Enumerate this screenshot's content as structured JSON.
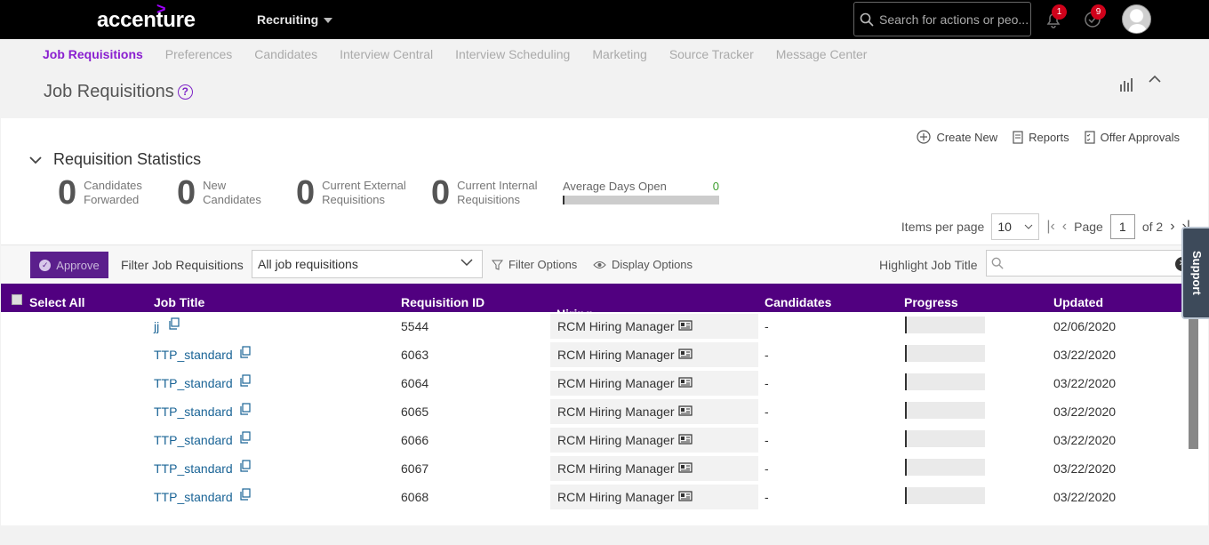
{
  "header": {
    "logo_text": "accenture",
    "logo_mark": ">",
    "module": "Recruiting",
    "search_placeholder": "Search for actions or peo...",
    "notifications_count": "1",
    "approvals_count": "9"
  },
  "subnav": {
    "items": [
      "Job Requisitions",
      "Preferences",
      "Candidates",
      "Interview Central",
      "Interview Scheduling",
      "Marketing",
      "Source Tracker",
      "Message Center"
    ]
  },
  "page": {
    "title": "Job Requisitions",
    "help": "?"
  },
  "actions": {
    "create_new": "Create New",
    "reports": "Reports",
    "offer_approvals": "Offer Approvals"
  },
  "stats": {
    "heading": "Requisition Statistics",
    "candidates_forwarded": {
      "value": "0",
      "label1": "Candidates",
      "label2": "Forwarded"
    },
    "new_candidates": {
      "value": "0",
      "label1": "New",
      "label2": "Candidates"
    },
    "current_external": {
      "value": "0",
      "label1": "Current External",
      "label2": "Requisitions"
    },
    "current_internal": {
      "value": "0",
      "label1": "Current Internal",
      "label2": "Requisitions"
    },
    "avg_days_label": "Average Days Open",
    "avg_days_value": "0"
  },
  "pager": {
    "items_per_page_label": "Items per page",
    "items_per_page": "10",
    "page_label": "Page",
    "page": "1",
    "of_label": "of 2"
  },
  "filter": {
    "approve": "Approve",
    "label": "Filter Job Requisitions",
    "selected": "All job requisitions",
    "filter_options": "Filter Options",
    "display_options": "Display Options",
    "highlight_label": "Highlight Job Title"
  },
  "table": {
    "columns": [
      "Select All",
      "Job Title",
      "Requisition ID",
      "Hiring Manager",
      "Candidates",
      "Progress",
      "Updated"
    ],
    "rows": [
      {
        "title": "jj",
        "id": "5544",
        "manager": "RCM Hiring Manager",
        "candidates": "-",
        "updated": "02/06/2020",
        "progress": 0
      },
      {
        "title": "TTP_standard",
        "id": "6063",
        "manager": "RCM Hiring Manager",
        "candidates": "-",
        "updated": "03/22/2020",
        "progress": 0
      },
      {
        "title": "TTP_standard",
        "id": "6064",
        "manager": "RCM Hiring Manager",
        "candidates": "-",
        "updated": "03/22/2020",
        "progress": 0
      },
      {
        "title": "TTP_standard",
        "id": "6065",
        "manager": "RCM Hiring Manager",
        "candidates": "-",
        "updated": "03/22/2020",
        "progress": 0
      },
      {
        "title": "TTP_standard",
        "id": "6066",
        "manager": "RCM Hiring Manager",
        "candidates": "-",
        "updated": "03/22/2020",
        "progress": 0
      },
      {
        "title": "TTP_standard",
        "id": "6067",
        "manager": "RCM Hiring Manager",
        "candidates": "-",
        "updated": "03/22/2020",
        "progress": 0
      },
      {
        "title": "TTP_standard",
        "id": "6068",
        "manager": "RCM Hiring Manager",
        "candidates": "-",
        "updated": "03/22/2020",
        "progress": 0
      }
    ]
  },
  "support": "Support",
  "colors": {
    "accent": "#8a1fd0",
    "header_row": "#510080",
    "topbar": "#000000"
  }
}
